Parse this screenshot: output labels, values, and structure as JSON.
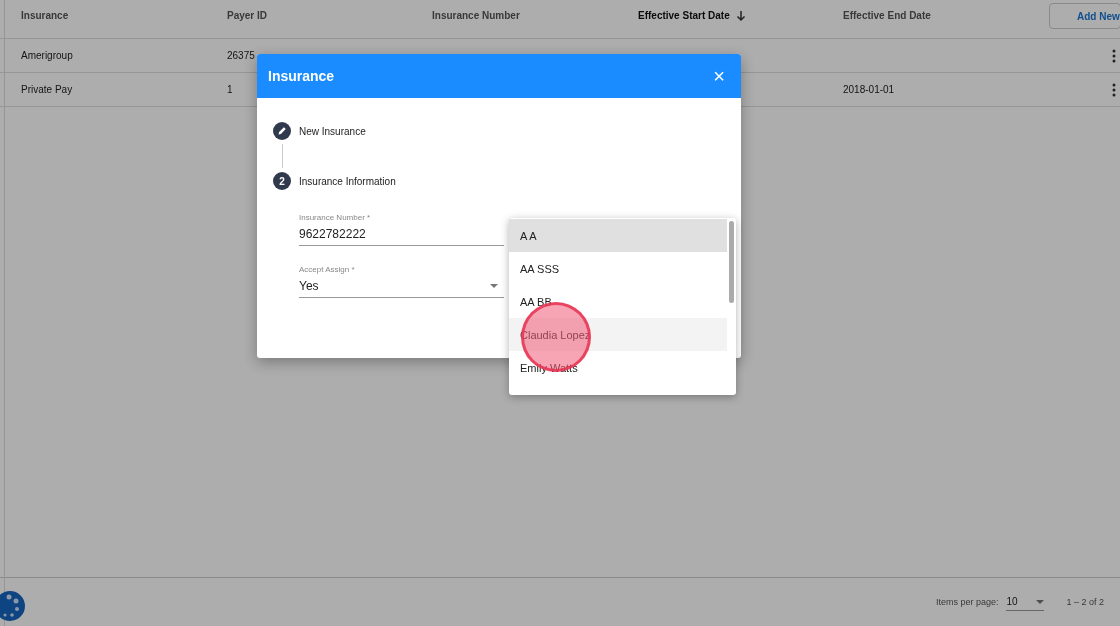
{
  "table": {
    "columns": [
      {
        "label": "Insurance",
        "sorted": false
      },
      {
        "label": "Payer ID",
        "sorted": false
      },
      {
        "label": "Insurance Number",
        "sorted": false
      },
      {
        "label": "Effective Start Date",
        "sorted": true
      },
      {
        "label": "Effective End Date",
        "sorted": false
      }
    ],
    "add_button": "Add New",
    "rows": [
      {
        "cells": [
          "Amerigroup",
          "26375",
          "",
          "",
          ""
        ]
      },
      {
        "cells": [
          "Private Pay",
          "1",
          "",
          "",
          "2018-01-01"
        ]
      }
    ]
  },
  "paginator": {
    "label": "Items per page:",
    "page_size": "10",
    "range": "1 – 2 of 2"
  },
  "dialog": {
    "title": "Insurance",
    "close": "×",
    "steps": [
      {
        "kind": "edit",
        "label": "New Insurance"
      },
      {
        "kind": "number",
        "label": "Insurance Information",
        "number": "2"
      }
    ],
    "fields": [
      {
        "kind": "text",
        "label": "Insurance Number *",
        "value": "9622782222"
      },
      {
        "kind": "select",
        "label": "Accept Assign *",
        "value": "Yes"
      }
    ]
  },
  "dropdown": {
    "options": [
      {
        "label": "A A",
        "selected": true,
        "hovered": false
      },
      {
        "label": "AA SSS",
        "selected": false,
        "hovered": false
      },
      {
        "label": "AA BB",
        "selected": false,
        "hovered": false
      },
      {
        "label": "Claudia Lopez",
        "selected": false,
        "hovered": true
      },
      {
        "label": "Emily Watts",
        "selected": false,
        "hovered": false
      }
    ]
  }
}
